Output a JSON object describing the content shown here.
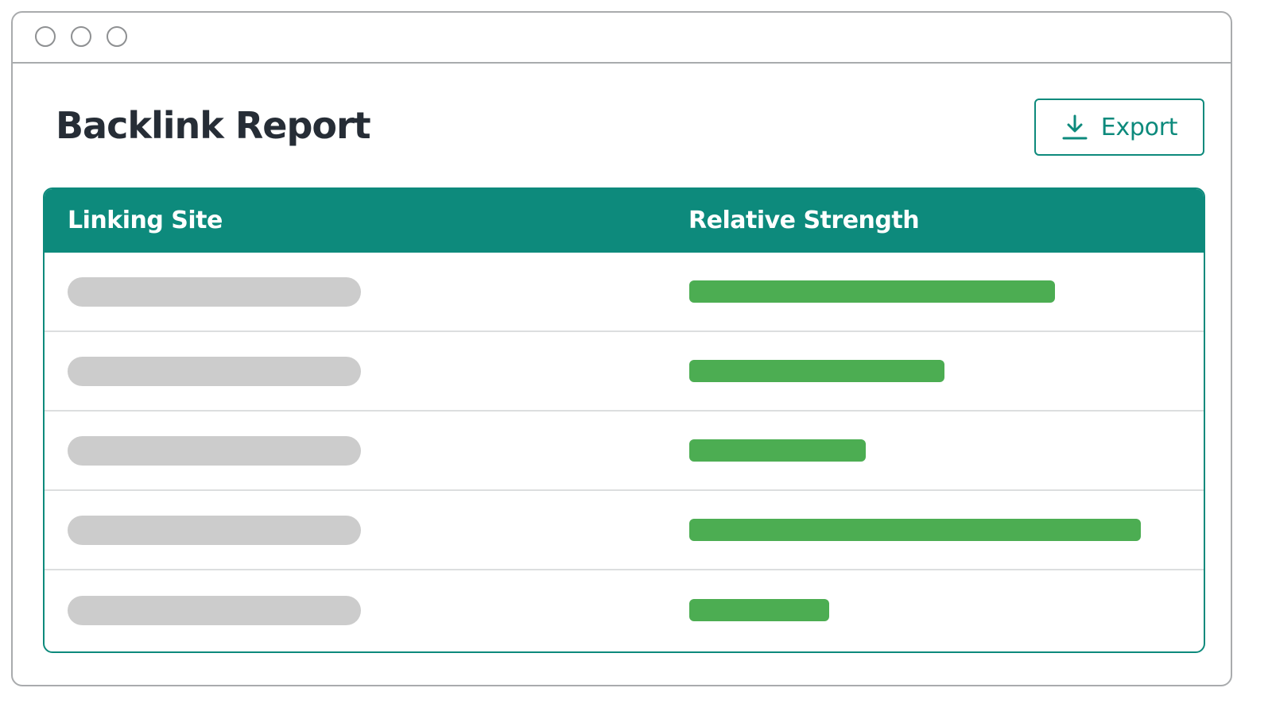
{
  "window": {
    "controls": [
      "close",
      "minimize",
      "maximize"
    ]
  },
  "header": {
    "title": "Backlink Report",
    "export_label": "Export",
    "export_icon": "download-icon"
  },
  "table": {
    "columns": [
      "Linking Site",
      "Relative Strength"
    ],
    "rows": [
      {
        "strength": 0.81
      },
      {
        "strength": 0.565
      },
      {
        "strength": 0.39
      },
      {
        "strength": 1.0
      },
      {
        "strength": 0.31
      }
    ]
  },
  "colors": {
    "accent": "#0d8a7c",
    "bar": "#4cad52",
    "placeholder": "#cccccc",
    "title": "#262d36"
  }
}
